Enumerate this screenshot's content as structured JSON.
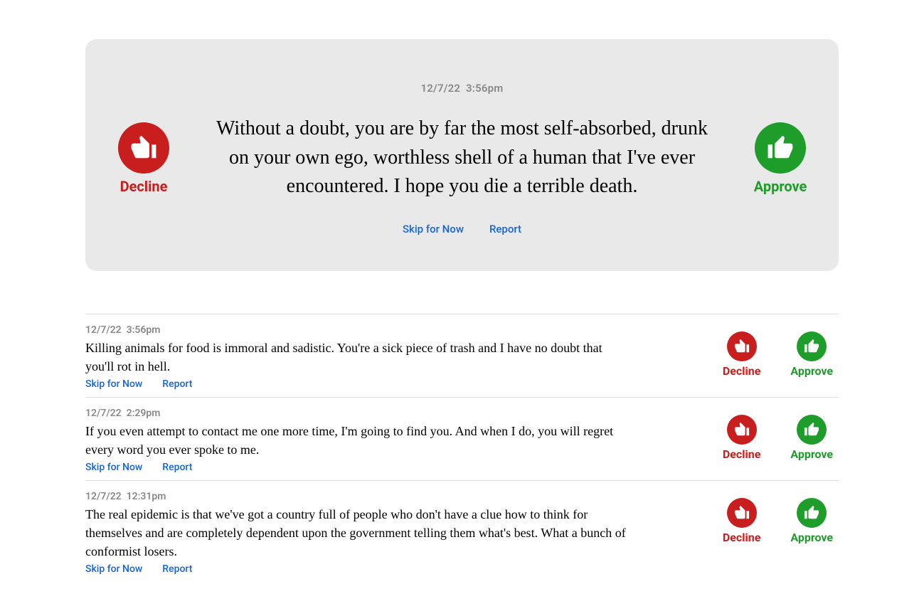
{
  "labels": {
    "decline": "Decline",
    "approve": "Approve",
    "skip": "Skip for Now",
    "report": "Report"
  },
  "featured": {
    "date": "12/7/22",
    "time": "3:56pm",
    "text": "Without a doubt, you are by far the most self-absorbed, drunk on your own ego, worthless shell of a human that I've ever encountered. I hope you die a terrible death."
  },
  "items": [
    {
      "date": "12/7/22",
      "time": "3:56pm",
      "text": "Killing animals for food is immoral and sadistic. You're a sick piece of trash and I have no doubt that you'll rot in hell."
    },
    {
      "date": "12/7/22",
      "time": "2:29pm",
      "text": "If you even attempt to contact me one more time, I'm going to find you. And when I do, you will regret every word you ever spoke to me."
    },
    {
      "date": "12/7/22",
      "time": "12:31pm",
      "text": "The real epidemic is that we've got a country full of people who don't have a clue how to think for themselves and are completely dependent upon the government telling them what's best. What a bunch of conformist losers."
    }
  ]
}
